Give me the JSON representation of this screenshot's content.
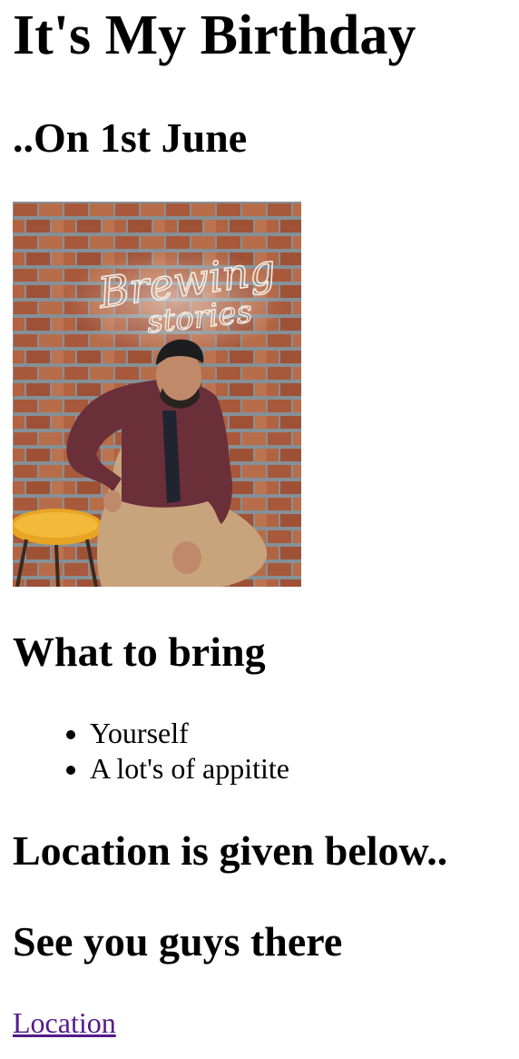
{
  "page": {
    "title": "It's My Birthday",
    "subtitle": "..On 1st June",
    "photo": {
      "neon_sign": [
        "Brewing",
        "stories"
      ]
    },
    "bring": {
      "heading": "What to bring",
      "items": [
        "Yourself",
        "A lot's of appitite"
      ]
    },
    "location_heading": "Location is given below..",
    "closing": "See you guys there",
    "location_link": "Location"
  },
  "colors": {
    "link_visited": "#551a8b",
    "brick": "#b86a48",
    "mortar": "#8f9aa0",
    "jacket": "#6b2f3a",
    "pants": "#c8a47c",
    "stool": "#e8a423"
  }
}
